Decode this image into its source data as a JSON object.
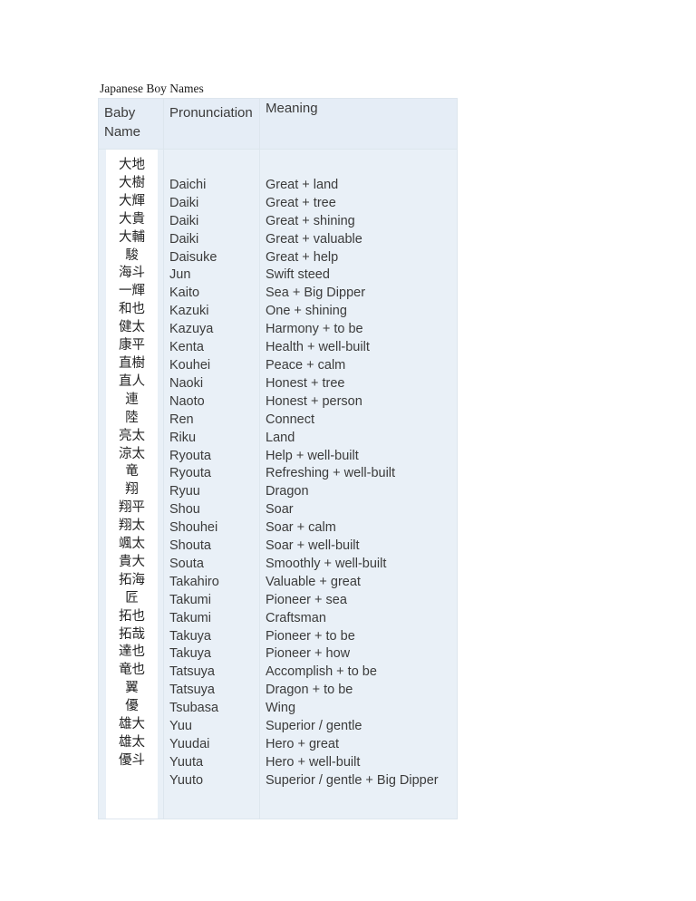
{
  "document": {
    "title": "Japanese Boy Names"
  },
  "table": {
    "headers": {
      "baby_name": "Baby Name",
      "pronunciation": "Pronunciation",
      "meaning": "Meaning"
    },
    "colors": {
      "cell_background": "#e9f0f7",
      "header_background": "#e5edf6",
      "kanji_panel_background": "#ffffff",
      "border": "#dde6ee",
      "text": "#3b3b3b",
      "page_background": "#ffffff"
    },
    "baby_names": [
      "大地",
      "大樹",
      "大輝",
      "大貴",
      "大輔",
      "駿",
      "海斗",
      "一輝",
      "和也",
      "健太",
      "康平",
      "直樹",
      "直人",
      "連",
      "陸",
      "亮太",
      "涼太",
      "竜",
      "翔",
      "翔平",
      "翔太",
      "颯太",
      "貴大",
      "拓海",
      "匠",
      "拓也",
      "拓哉",
      "達也",
      "竜也",
      "翼",
      "優",
      "雄大",
      "雄太",
      "優斗"
    ],
    "pronunciations": [
      "Daichi",
      "Daiki",
      "Daiki",
      "Daiki",
      "Daisuke",
      "Jun",
      "Kaito",
      "Kazuki",
      "Kazuya",
      "Kenta",
      "Kouhei",
      "Naoki",
      "Naoto",
      "Ren",
      "Riku",
      "Ryouta",
      "Ryouta",
      "Ryuu",
      "Shou",
      "Shouhei",
      "Shouta",
      "Souta",
      "Takahiro",
      "Takumi",
      "Takumi",
      "Takuya",
      "Takuya",
      "Tatsuya",
      "Tatsuya",
      "Tsubasa",
      "Yuu",
      "Yuudai",
      "Yuuta",
      "Yuuto"
    ],
    "meanings": [
      "Great + land",
      "Great + tree",
      "Great + shining",
      "Great + valuable",
      "Great + help",
      "Swift steed",
      "Sea + Big Dipper",
      "One + shining",
      "Harmony + to be",
      "Health + well-built",
      "Peace + calm",
      "Honest + tree",
      "Honest + person",
      "Connect",
      "Land",
      "Help + well-built",
      "Refreshing + well-built",
      "Dragon",
      "Soar",
      "Soar + calm",
      "Soar + well-built",
      "Smoothly + well-built",
      "Valuable + great",
      "Pioneer + sea",
      "Craftsman",
      "Pioneer + to be",
      "Pioneer + how",
      "Accomplish + to be",
      "Dragon + to be",
      "Wing",
      "Superior / gentle",
      "Hero + great",
      "Hero + well-built",
      "Superior / gentle + Big Dipper"
    ],
    "leading_blank_lines": {
      "pronunciation": 1,
      "meaning": 1
    }
  }
}
